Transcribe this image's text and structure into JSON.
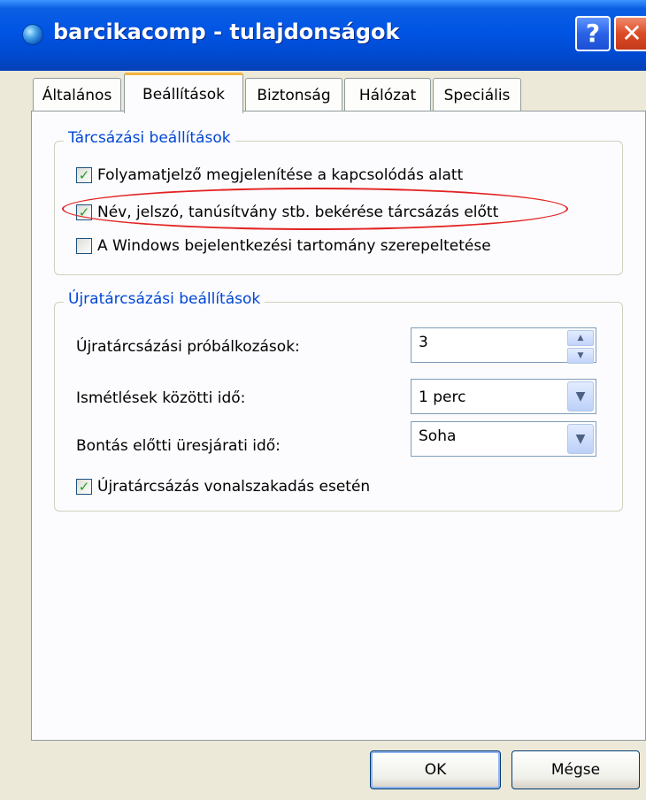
{
  "window": {
    "title": "barcikacomp - tulajdonságok",
    "help_label": "?",
    "close_label": "✕"
  },
  "tabs": [
    {
      "label": "Általános",
      "active": false
    },
    {
      "label": "Beállítások",
      "active": true
    },
    {
      "label": "Biztonság",
      "active": false
    },
    {
      "label": "Hálózat",
      "active": false
    },
    {
      "label": "Speciális",
      "active": false
    }
  ],
  "dial_settings": {
    "legend": "Tárcsázási beállítások",
    "options": [
      {
        "label": "Folyamatjelző megjelenítése a kapcsolódás alatt",
        "checked": true
      },
      {
        "label": "Név, jelszó, tanúsítvány stb. bekérése tárcsázás előtt",
        "checked": true
      },
      {
        "label": "A Windows bejelentkezési tartomány szerepeltetése",
        "checked": false
      }
    ]
  },
  "redial_settings": {
    "legend": "Újratárcsázási beállítások",
    "attempts_label": "Újratárcsázási próbálkozások:",
    "attempts_value": "3",
    "interval_label": "Ismétlések közötti idő:",
    "interval_value": "1 perc",
    "idle_label": "Bontás előtti üresjárati idő:",
    "idle_value": "Soha",
    "redial_on_drop": {
      "label": "Újratárcsázás vonalszakadás esetén",
      "checked": true
    }
  },
  "buttons": {
    "ok": "OK",
    "cancel": "Mégse"
  },
  "check_glyph": "✓",
  "colors": {
    "title_bar": "#0054e3",
    "legend_text": "#0046d5",
    "annotation": "#e32222",
    "check": "#21a121"
  }
}
